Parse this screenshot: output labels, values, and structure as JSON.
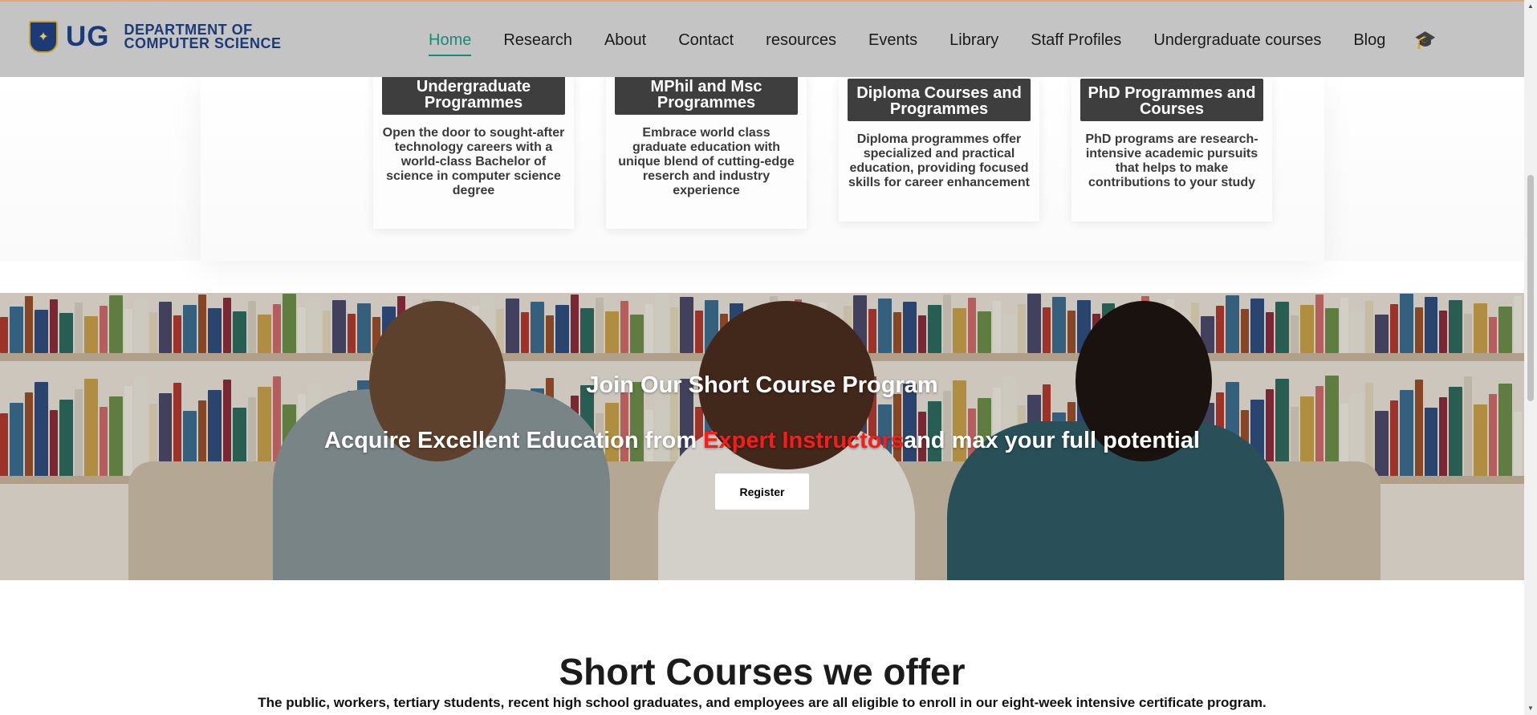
{
  "header": {
    "logo_text": "UG",
    "dept_line1": "DEPARTMENT OF",
    "dept_line2": "COMPUTER SCIENCE",
    "nav": [
      "Home",
      "Research",
      "About",
      "Contact",
      "resources",
      "Events",
      "Library",
      "Staff Profiles",
      "Undergraduate courses",
      "Blog"
    ],
    "active_nav": "Home",
    "accent_color": "#1a8a76",
    "header_bg": "#c4c4c4",
    "icon": "graduation-cap-icon"
  },
  "programs": [
    {
      "title": "Undergraduate Programmes",
      "text": "Open the door to sought-after technology careers with a world-class Bachelor of science in computer science degree"
    },
    {
      "title": "MPhil and Msc Programmes",
      "text": "Embrace world class graduate education with unique blend of cutting-edge reserch and industry experience"
    },
    {
      "title": "Diploma Courses and Programmes",
      "text": "Diploma programmes offer specialized and practical education, providing focused skills for career enhancement"
    },
    {
      "title": "PhD Programmes and Courses",
      "text": "PhD programs are research-intensive academic pursuits that helps to make contributions to your study"
    }
  ],
  "hero": {
    "title": "Join Our Short Course Program",
    "subtitle_before": "Acquire Excellent Education from ",
    "subtitle_highlight": "Expert Instructors",
    "subtitle_after": "and max your full potential",
    "highlight_color": "#ff1a1a",
    "register_label": "Register"
  },
  "short_courses": {
    "title": "Short Courses we offer",
    "description": "The public, workers, tertiary students, recent high school graduates, and employees are all eligible to enroll in our eight-week intensive certificate program."
  }
}
